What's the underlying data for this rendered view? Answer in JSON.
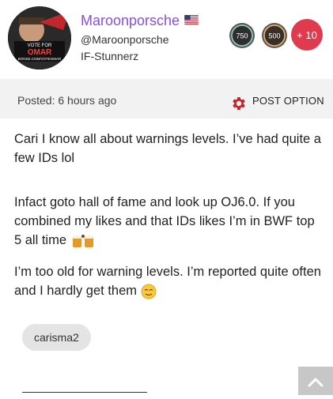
{
  "author": {
    "username": "Maroonporsche",
    "handle": "@Maroonporsche",
    "team": "IF-Stunnerz",
    "avatar_text": [
      "VOTE FOR",
      "OMAR",
      "BONSE.COM/VOTEOMAR"
    ],
    "flag": "us-flag-icon"
  },
  "badges": {
    "badge1": "750",
    "badge2": "500",
    "more": "+ 10"
  },
  "meta": {
    "posted": "Posted: 6 hours ago",
    "post_option": "POST OPTION"
  },
  "post": {
    "p1": "Cari I know all about warnings levels. I’ve had quite a few IDs lol",
    "p2": "Infact goto hall of fame and look up OJ6.0. If you combined my likes and that IDs likes I’m in BWF top 5 all time",
    "p3": "I’m too old for warning levels. I’m reported quite often and I hardly get them"
  },
  "tag": "carisma2",
  "colors": {
    "username": "#8a4fd8",
    "more_badge": "#e03a4e",
    "meta_bg": "#f2f2f2",
    "gear": "#c0282d"
  }
}
